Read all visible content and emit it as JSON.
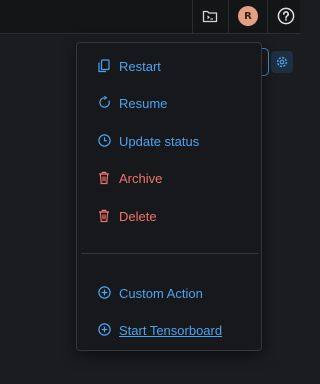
{
  "topbar": {
    "avatar_initial": "R"
  },
  "icons": {
    "folder": "folder-terminal-icon",
    "help": "help-circle-icon",
    "gear": "gear-icon"
  },
  "colors": {
    "accent": "#4ba3f2",
    "danger": "#f07468",
    "avatar_bg": "#e3a184"
  },
  "menu": {
    "items": [
      {
        "label": "Restart",
        "icon": "copy-icon",
        "tone": "blue"
      },
      {
        "label": "Resume",
        "icon": "refresh-icon",
        "tone": "blue"
      },
      {
        "label": "Update status",
        "icon": "clock-icon",
        "tone": "blue"
      },
      {
        "label": "Archive",
        "icon": "trash-icon",
        "tone": "red"
      },
      {
        "label": "Delete",
        "icon": "trash-icon",
        "tone": "red"
      }
    ],
    "extra_items": [
      {
        "label": "Custom Action",
        "icon": "plus-circle-icon",
        "tone": "blue"
      },
      {
        "label": "Start Tensorboard",
        "icon": "plus-circle-icon",
        "tone": "blue"
      }
    ]
  }
}
